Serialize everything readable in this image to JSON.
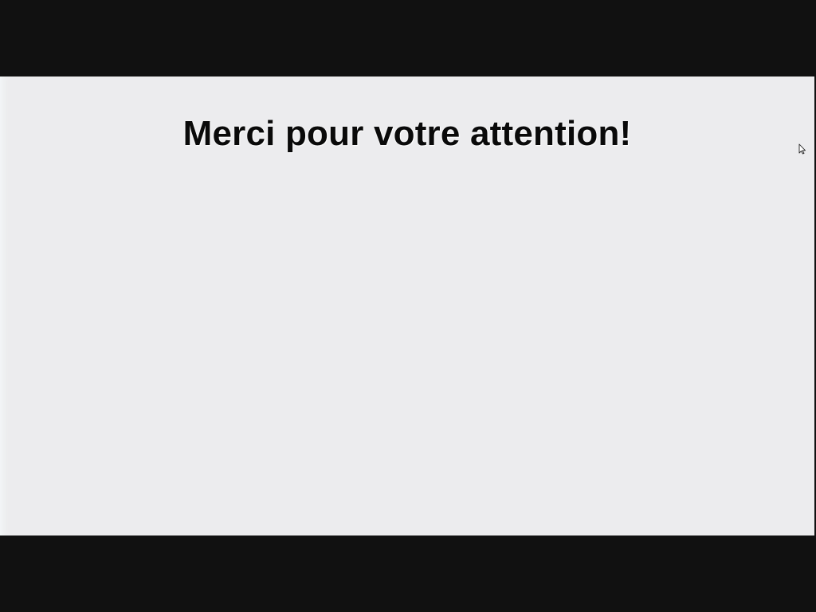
{
  "slide": {
    "title": "Merci pour votre attention!"
  },
  "cursor": {
    "icon": "arrow-pointer-icon"
  },
  "colors": {
    "letterbox": "#111111",
    "slide_background": "#ececee",
    "title_text": "#0a0a0a"
  }
}
